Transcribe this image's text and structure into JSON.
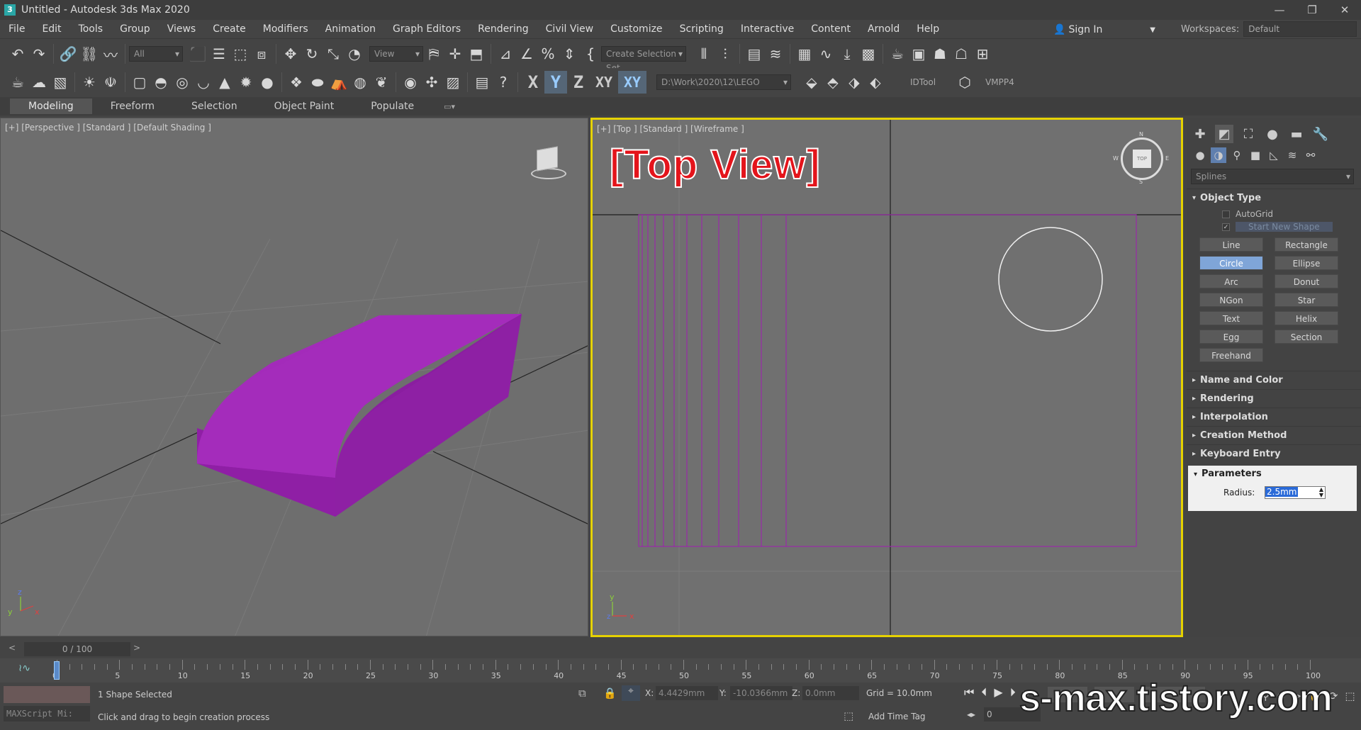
{
  "window": {
    "title": "Untitled - Autodesk 3ds Max 2020",
    "logo": "3"
  },
  "menu": [
    "File",
    "Edit",
    "Tools",
    "Group",
    "Views",
    "Create",
    "Modifiers",
    "Animation",
    "Graph Editors",
    "Rendering",
    "Civil View",
    "Customize",
    "Scripting",
    "Interactive",
    "Content",
    "Arnold",
    "Help"
  ],
  "signin": "Sign In",
  "workspaces": {
    "label": "Workspaces:",
    "value": "Default"
  },
  "toolbar1": {
    "filter": "All",
    "refcoord": "View",
    "selset": "Create Selection Set"
  },
  "toolbar2": {
    "axes": [
      "X",
      "Y",
      "Z",
      "XY",
      "XY"
    ],
    "path": "D:\\Work\\2020\\12\\LEGO",
    "idtool": "IDTool",
    "vmpp": "VMPP4"
  },
  "ribbon_tabs": [
    "Modeling",
    "Freeform",
    "Selection",
    "Object Paint",
    "Populate"
  ],
  "viewport_left": {
    "label": "[+] [Perspective ] [Standard ] [Default Shading ]",
    "object_color": "#a12bb8"
  },
  "viewport_right": {
    "label": "[+] [Top ] [Standard ] [Wireframe ]",
    "overlay": "[Top View]",
    "viewcube": "TOP",
    "compass": [
      "N",
      "S",
      "E",
      "W"
    ]
  },
  "command_panel": {
    "category": "Splines",
    "object_type": "Object Type",
    "autogrid": "AutoGrid",
    "start_new_shape": "Start New Shape",
    "buttons": [
      [
        "Line",
        "Rectangle"
      ],
      [
        "Circle",
        "Ellipse"
      ],
      [
        "Arc",
        "Donut"
      ],
      [
        "NGon",
        "Star"
      ],
      [
        "Text",
        "Helix"
      ],
      [
        "Egg",
        "Section"
      ],
      [
        "Freehand",
        ""
      ]
    ],
    "selected": "Circle",
    "rollouts": [
      "Name and Color",
      "Rendering",
      "Interpolation",
      "Creation Method",
      "Keyboard Entry"
    ],
    "parameters": {
      "title": "Parameters",
      "radius_label": "Radius:",
      "radius_value": "2.5mm"
    }
  },
  "timeline": {
    "slider": "0 / 100",
    "ticks": [
      "0",
      "5",
      "10",
      "15",
      "20",
      "25",
      "30",
      "35",
      "40",
      "45",
      "50",
      "55",
      "60",
      "65",
      "70",
      "75",
      "80",
      "85",
      "90",
      "95",
      "100"
    ]
  },
  "status": {
    "maxscript": "MAXScript Mi:",
    "selected": "1 Shape Selected",
    "prompt": "Click and drag to begin creation process",
    "x_label": "X:",
    "x_value": "4.4429mm",
    "y_label": "Y:",
    "y_value": "-10.0366mm",
    "z_label": "Z:",
    "z_value": "0.0mm",
    "grid": "Grid = 10.0mm",
    "add_time_tag": "Add Time Tag",
    "frame": "0"
  },
  "watermark": "s-max.tistory.com"
}
